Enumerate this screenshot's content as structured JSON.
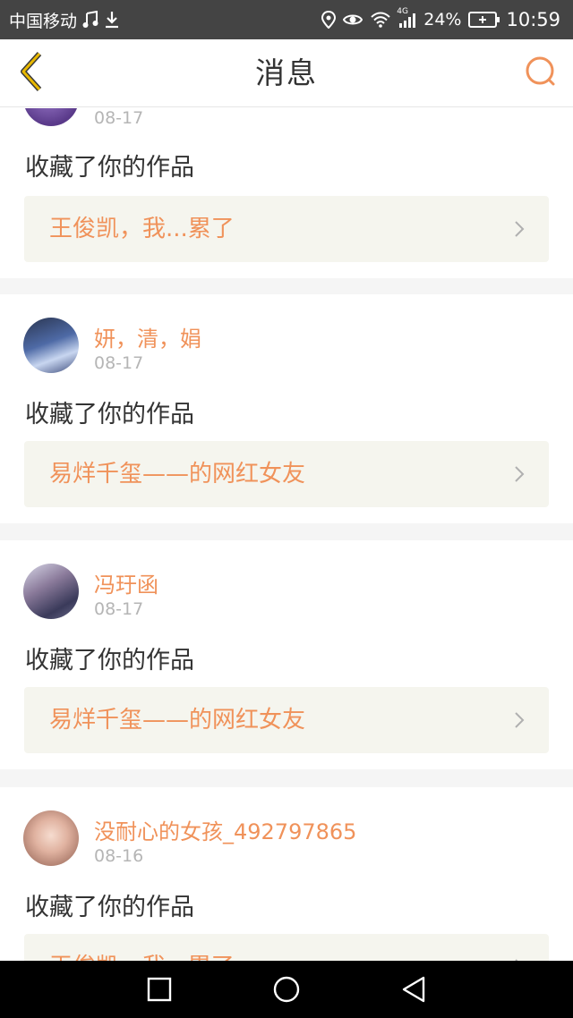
{
  "status_bar": {
    "carrier": "中国移动",
    "network": "4G",
    "battery": "24%",
    "time": "10:59",
    "icons": [
      "music-note-icon",
      "download-icon",
      "location-icon",
      "eye-icon",
      "wifi-icon",
      "signal-icon",
      "battery-icon"
    ]
  },
  "header": {
    "title": "消息",
    "back_icon": "chevron-left-icon",
    "search_icon": "search-icon",
    "accent_color": "#f0925a",
    "back_color": "#e8b800"
  },
  "messages": [
    {
      "user": "",
      "date": "08-17",
      "action": "收藏了你的作品",
      "work_title": "王俊凯，我...累了",
      "avatar": "purple-avatar"
    },
    {
      "user": "妍，清，娟",
      "date": "08-17",
      "action": "收藏了你的作品",
      "work_title": "易烊千玺——的网红女友",
      "avatar": "blue-robe-avatar"
    },
    {
      "user": "冯玗函",
      "date": "08-17",
      "action": "收藏了你的作品",
      "work_title": "易烊千玺——的网红女友",
      "avatar": "hair-bun-avatar"
    },
    {
      "user": "没耐心的女孩_492797865",
      "date": "08-16",
      "action": "收藏了你的作品",
      "work_title": "王俊凯，我...累了",
      "avatar": "portrait-avatar"
    }
  ],
  "nav_bar": {
    "buttons": [
      "recent-apps-icon",
      "home-icon",
      "back-icon"
    ]
  }
}
